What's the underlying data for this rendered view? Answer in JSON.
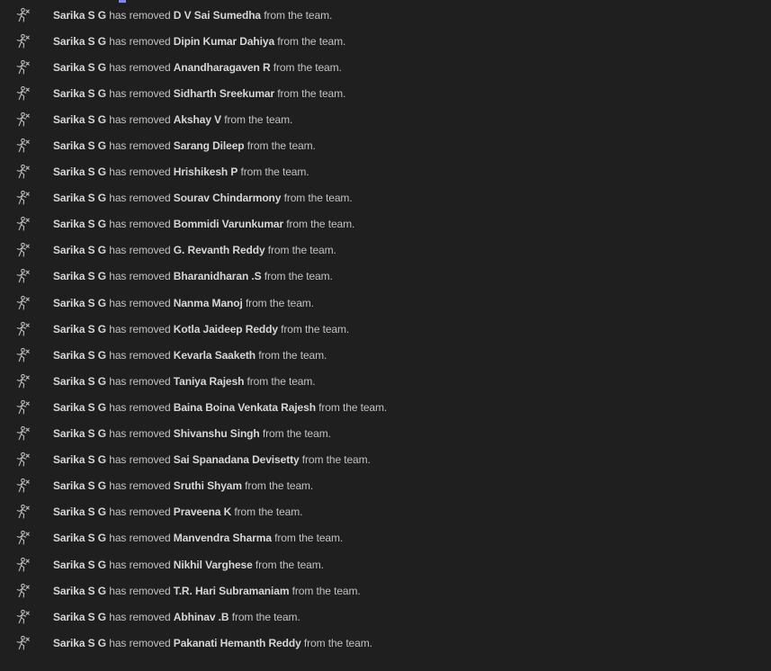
{
  "feed": {
    "actor": "Sarika S G",
    "action_text": " has removed ",
    "suffix_text": " from the team.",
    "icon": "person-remove-icon",
    "accent_color": "#7f85f5",
    "removed_members": [
      "D V Sai Sumedha",
      "Dipin Kumar Dahiya",
      "Anandharagaven R",
      "Sidharth Sreekumar",
      "Akshay V",
      "Sarang Dileep",
      "Hrishikesh P",
      "Sourav Chindarmony",
      "Bommidi Varunkumar",
      "G. Revanth Reddy",
      "Bharanidharan .S",
      "Nanma Manoj",
      "Kotla Jaideep Reddy",
      "Kevarla Saaketh",
      "Taniya Rajesh",
      "Baina Boina Venkata Rajesh",
      "Shivanshu Singh",
      "Sai Spanadana Devisetty",
      "Sruthi Shyam",
      "Praveena K",
      "Manvendra Sharma",
      "Nikhil Varghese",
      "T.R. Hari Subramaniam",
      "Abhinav .B",
      "Pakanati Hemanth Reddy"
    ]
  }
}
